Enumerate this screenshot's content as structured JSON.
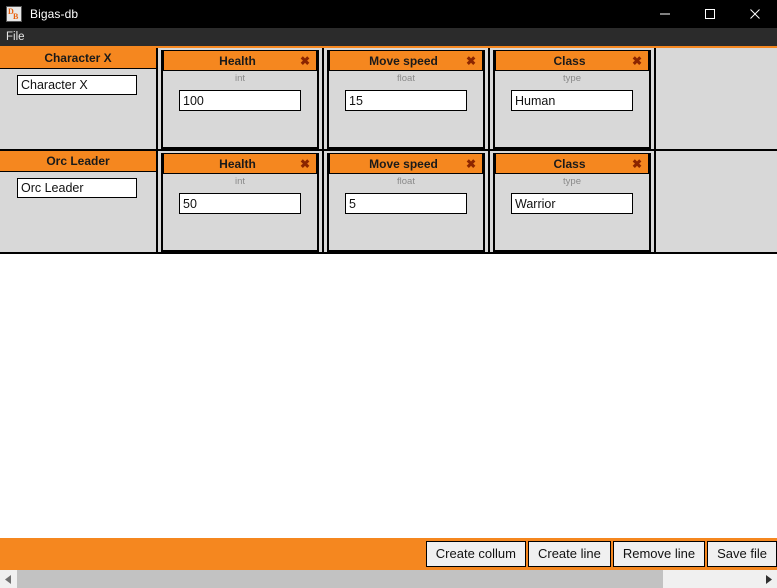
{
  "window": {
    "title": "Bigas-db",
    "icon": "app-db-icon",
    "controls": {
      "minimize": "minimize-icon",
      "maximize": "maximize-icon",
      "close": "close-icon"
    }
  },
  "menubar": {
    "items": [
      {
        "label": "File"
      }
    ]
  },
  "colors": {
    "accent_orange": "#f5871f",
    "panel_gray": "#d8d8d8",
    "titlebar": "#000000",
    "menubar": "#2b2b2b",
    "delete_icon": "#8b2500"
  },
  "table": {
    "delete_icon_name": "delete-column-icon",
    "rows": [
      {
        "name_header": "Character X",
        "name_value": "Character X",
        "fields": [
          {
            "header": "Health",
            "type": "int",
            "value": "100",
            "delete": "✖"
          },
          {
            "header": "Move speed",
            "type": "float",
            "value": "15",
            "delete": "✖"
          },
          {
            "header": "Class",
            "type": "type",
            "value": "Human",
            "delete": "✖"
          }
        ]
      },
      {
        "name_header": "Orc Leader",
        "name_value": "Orc Leader",
        "fields": [
          {
            "header": "Health",
            "type": "int",
            "value": "50",
            "delete": "✖"
          },
          {
            "header": "Move speed",
            "type": "float",
            "value": "5",
            "delete": "✖"
          },
          {
            "header": "Class",
            "type": "type",
            "value": "Warrior",
            "delete": "✖"
          }
        ]
      }
    ]
  },
  "bottombar": {
    "buttons": [
      {
        "label": "Create collum"
      },
      {
        "label": "Create line"
      },
      {
        "label": "Remove line"
      },
      {
        "label": "Save file"
      }
    ]
  },
  "scrollbar": {
    "left_arrow": "◀",
    "right_arrow": "▶"
  }
}
